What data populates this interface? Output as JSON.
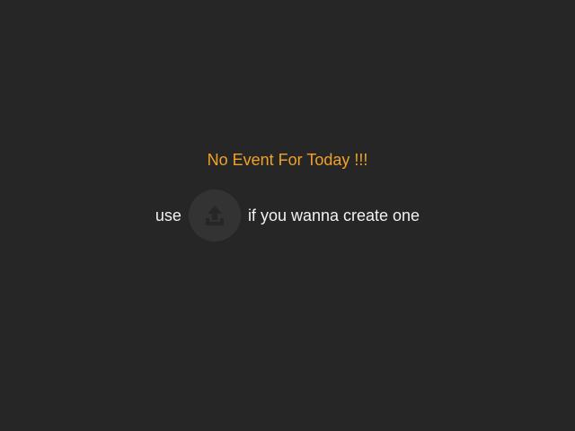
{
  "empty_state": {
    "message": "No Event For Today !!!",
    "hint_prefix": "use",
    "hint_suffix": "if you wanna create one",
    "upload_icon": "upload-icon"
  },
  "colors": {
    "background": "#262626",
    "message": "#f0a12b",
    "text": "#f2f2f2",
    "button_background": "#333333",
    "icon": "#262626"
  }
}
